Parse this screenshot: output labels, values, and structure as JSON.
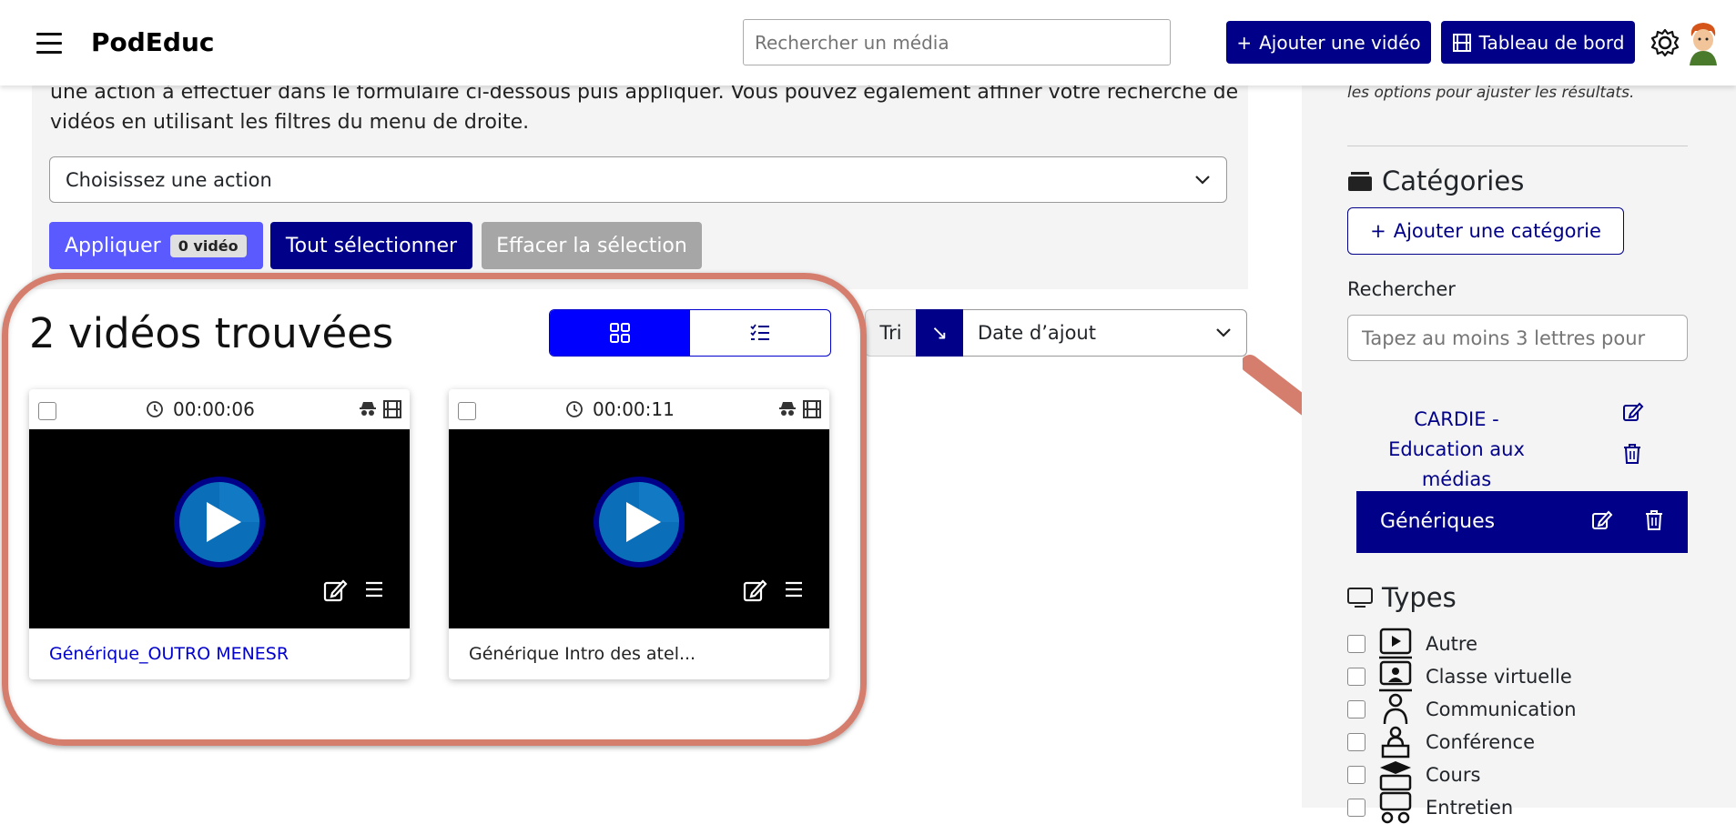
{
  "header": {
    "brand": "PodEduc",
    "search_placeholder": "Rechercher un média",
    "add_video_label": "Ajouter une vidéo",
    "dashboard_label": "Tableau de bord"
  },
  "panel": {
    "instructions": "une action à effectuer dans le formulaire ci-dessous puis appliquer. Vous pouvez également affiner votre recherche de vidéos en utilisant les filtres du menu de droite.",
    "action_select_value": "Choisissez une action",
    "apply_label": "Appliquer",
    "apply_badge": "0 vidéo",
    "select_all_label": "Tout sélectionner",
    "clear_selection_label": "Effacer la sélection"
  },
  "results": {
    "title": "2 vidéos trouvées",
    "sort_label": "Tri",
    "sort_direction_symbol": "↘",
    "sort_value": "Date d’ajout"
  },
  "videos": [
    {
      "duration": "00:00:06",
      "title": "Générique_OUTRO MENESR",
      "title_color": "#0000cc"
    },
    {
      "duration": "00:00:11",
      "title": "Générique Intro des atel...",
      "title_color": "#222222"
    }
  ],
  "sidebar": {
    "hint": "les options pour ajuster les résultats.",
    "categories_title": "Catégories",
    "add_category_label": "Ajouter une catégorie",
    "search_label": "Rechercher",
    "search_placeholder": "Tapez au moins 3 lettres pour",
    "categories": [
      {
        "label": "CARDIE - Education aux médias",
        "active": false
      },
      {
        "label": "Génériques",
        "active": true
      }
    ],
    "types_title": "Types",
    "types": [
      "Autre",
      "Classe virtuelle",
      "Communication",
      "Conférence",
      "Cours",
      "Entretien"
    ]
  },
  "colors": {
    "primary": "#000088",
    "active_toggle": "#0000ff",
    "apply_button": "#5a5aff",
    "clear_button": "#a6a6a6",
    "highlight": "#d67e6e"
  }
}
